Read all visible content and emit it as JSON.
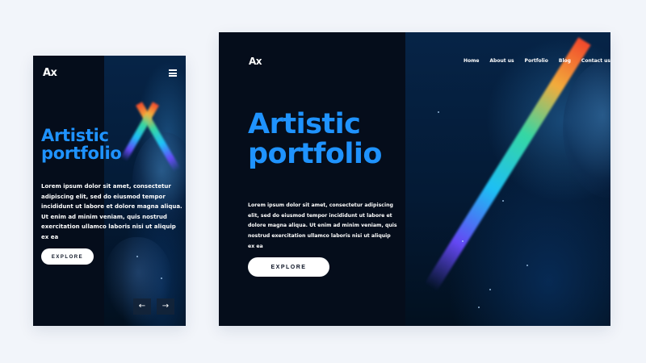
{
  "colors": {
    "accent": "#1f93ff",
    "background": "#050d1b",
    "page": "#f2f5fa"
  },
  "mobile": {
    "logo": "Ax",
    "menu_icon": "hamburger-menu-icon",
    "title_line1": "Artistic",
    "title_line2": "portfolio",
    "body": "Lorem ipsum dolor sit amet, consectetur adipiscing elit, sed do eiusmod tempor incididunt ut labore et dolore magna aliqua. Ut enim ad minim veniam, quis nostrud exercitation ullamco laboris nisi ut aliquip ex ea",
    "button_label": "EXPLORE",
    "prev_arrow": "←",
    "next_arrow": "→"
  },
  "desktop": {
    "logo": "Ax",
    "nav": [
      "Home",
      "About us",
      "Portfolio",
      "Blog",
      "Contact us"
    ],
    "title_line1": "Artistic",
    "title_line2": "portfolio",
    "body": "Lorem ipsum dolor sit amet, consectetur adipiscing elit, sed do eiusmod tempor incididunt ut labore et dolore magna aliqua. Ut enim ad minim veniam, quis nostrud exercitation ullamco laboris nisi ut aliquip ex ea",
    "button_label": "EXPLORE"
  }
}
